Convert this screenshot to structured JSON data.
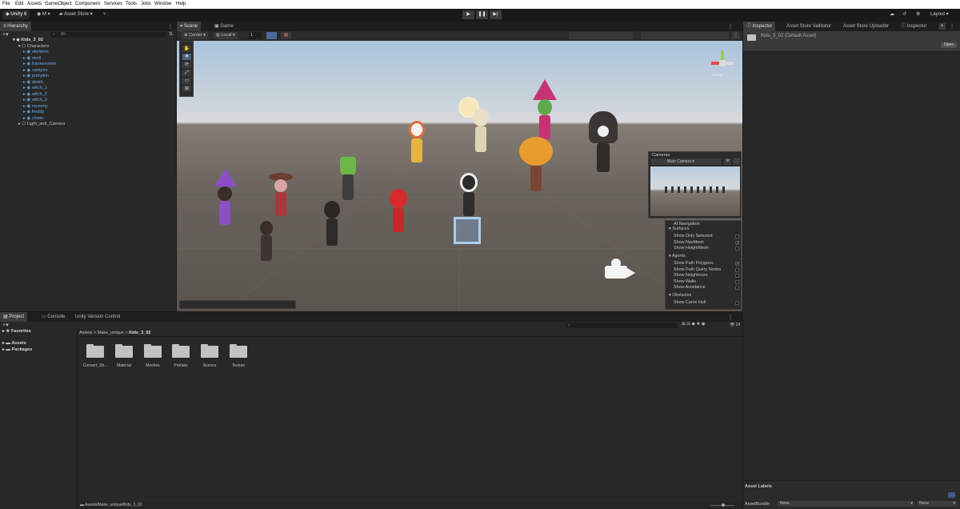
{
  "menubar": {
    "items": [
      "File",
      "Edit",
      "Assets",
      "GameObject",
      "Component",
      "Services",
      "Tools",
      "Jobs",
      "Window",
      "Help"
    ]
  },
  "toolbar": {
    "unity_label": "Unity 6",
    "account_label": "M",
    "asset_store_label": "Asset Store",
    "layout_label": "Layout"
  },
  "hierarchy": {
    "tab_label": "Hierarchy",
    "search_placeholder": "All",
    "scene_name": "Kids_3_02",
    "group_characters": "Characters",
    "characters": [
      "skeleton",
      "devil",
      "frankenstein",
      "vampire",
      "pumpkin",
      "death",
      "witch_1",
      "witch_2",
      "witch_3",
      "mummy",
      "freddy",
      "clown"
    ],
    "light_group": "Light_and_Camera"
  },
  "scene": {
    "tabs": [
      "Scene",
      "Game"
    ],
    "pivot_label": "Center",
    "space_label": "Local",
    "snap_value": "1",
    "gizmo_label": "Persp"
  },
  "cameras_overlay": {
    "title": "Cameras",
    "camera_select": "Main Camera"
  },
  "ai_nav": {
    "title": "AI Navigation",
    "surfaces_header": "Surfaces",
    "surfaces": [
      {
        "label": "Show Only Selected",
        "checked": false
      },
      {
        "label": "Show NavMesh",
        "checked": true
      },
      {
        "label": "Show HeightMesh",
        "checked": false
      }
    ],
    "agents_header": "Agents",
    "agents": [
      {
        "label": "Show Path Polygons",
        "checked": true
      },
      {
        "label": "Show Path Query Nodes",
        "checked": false
      },
      {
        "label": "Show Neighbours",
        "checked": false
      },
      {
        "label": "Show Walls",
        "checked": false
      },
      {
        "label": "Show Avoidance",
        "checked": false
      }
    ],
    "obstacles_header": "Obstacles",
    "obstacles": [
      {
        "label": "Show Carve Hull",
        "checked": false
      }
    ]
  },
  "project": {
    "tabs": [
      "Project",
      "Console",
      "Unity Version Control"
    ],
    "favorites_label": "Favorites",
    "assets_label": "Assets",
    "packages_label": "Packages",
    "breadcrumb": [
      "Assets",
      "Make_unique",
      "Kids_3_02"
    ],
    "folders": [
      "Convert_Sh...",
      "Material",
      "Meshes",
      "Prefabs",
      "Scenes",
      "Texture"
    ],
    "item_count": "24",
    "footer_path": "Assets/Make_unique/Kids_3_02"
  },
  "inspector": {
    "tabs": [
      "Inspector",
      "Asset Store Validator",
      "Asset Store Uploader",
      "Inspector"
    ],
    "asset_title": "Kids_3_02 (Default Asset)",
    "open_label": "Open",
    "asset_labels": "Asset Labels",
    "asset_bundle_label": "AssetBundle",
    "bundle_value": "None",
    "variant_value": "None"
  }
}
